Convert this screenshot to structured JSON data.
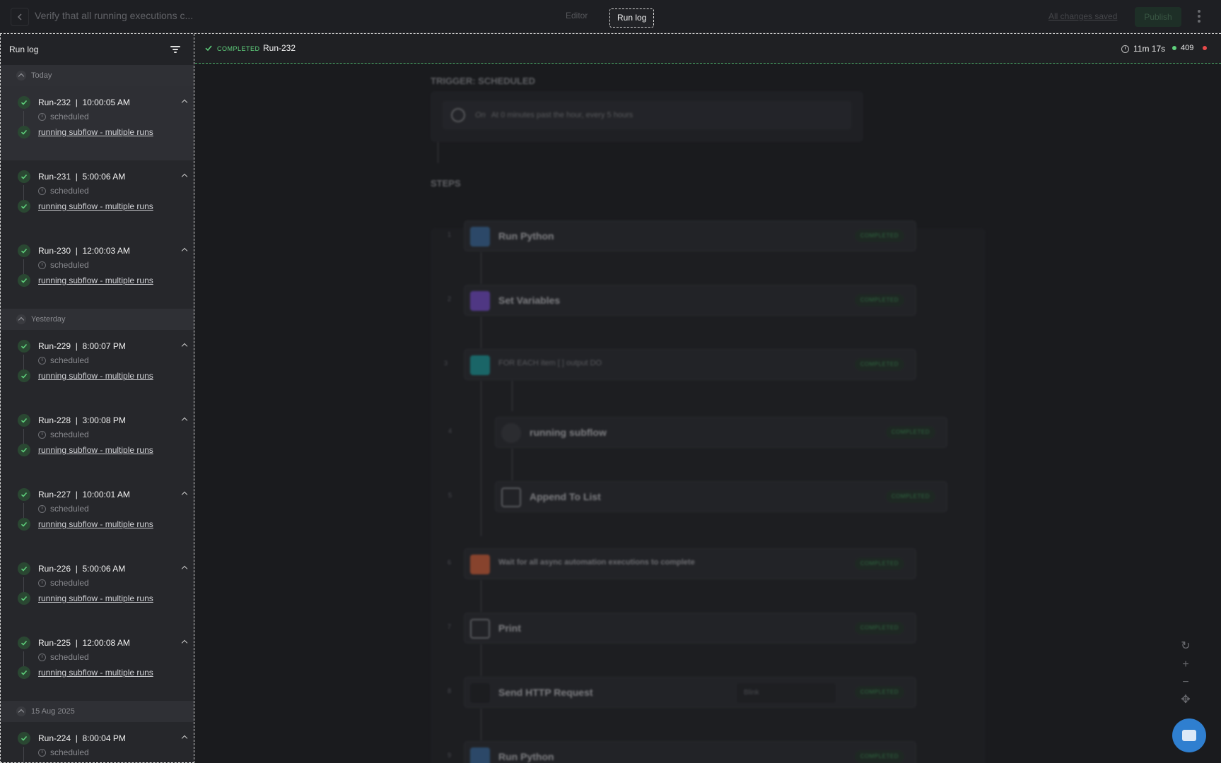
{
  "topbar": {
    "workflow_title": "Verify that all running executions c...",
    "mode_editor": "Editor",
    "mode_runlog": "Run log",
    "saved_status": "All changes saved",
    "publish_label": "Publish"
  },
  "sidebar": {
    "title": "Run log",
    "groups": [
      {
        "label": "Today",
        "runs": [
          {
            "id": "Run-232",
            "time": "10:00:05 AM",
            "trigger": "scheduled",
            "subflow": "running subflow - multiple runs"
          },
          {
            "id": "Run-231",
            "time": "5:00:06 AM",
            "trigger": "scheduled",
            "subflow": "running subflow - multiple runs"
          },
          {
            "id": "Run-230",
            "time": "12:00:03 AM",
            "trigger": "scheduled",
            "subflow": "running subflow - multiple runs"
          }
        ]
      },
      {
        "label": "Yesterday",
        "runs": [
          {
            "id": "Run-229",
            "time": "8:00:07 PM",
            "trigger": "scheduled",
            "subflow": "running subflow - multiple runs"
          },
          {
            "id": "Run-228",
            "time": "3:00:08 PM",
            "trigger": "scheduled",
            "subflow": "running subflow - multiple runs"
          },
          {
            "id": "Run-227",
            "time": "10:00:01 AM",
            "trigger": "scheduled",
            "subflow": "running subflow - multiple runs"
          },
          {
            "id": "Run-226",
            "time": "5:00:06 AM",
            "trigger": "scheduled",
            "subflow": "running subflow - multiple runs"
          },
          {
            "id": "Run-225",
            "time": "12:00:08 AM",
            "trigger": "scheduled",
            "subflow": "running subflow - multiple runs"
          }
        ]
      },
      {
        "label": "15 Aug 2025",
        "runs": [
          {
            "id": "Run-224",
            "time": "8:00:04 PM",
            "trigger": "scheduled",
            "subflow": "running subflow - multiple runs"
          }
        ]
      }
    ]
  },
  "status": {
    "state": "COMPLETED",
    "run_id": "Run-232",
    "duration": "11m 17s",
    "count": "409",
    "success_color": "#5fd07c",
    "error_color": "#e84a4a"
  },
  "flow": {
    "trigger_heading": "TRIGGER: SCHEDULED",
    "trigger_on": "On",
    "trigger_schedule": "At 0 minutes past the hour, every 5 hours",
    "steps_heading": "STEPS",
    "completed_badge": "COMPLETED",
    "steps": [
      {
        "num": "1",
        "name": "Run Python",
        "icon": "python-icon",
        "color": "#3b6ea5"
      },
      {
        "num": "2",
        "name": "Set Variables",
        "icon": "variables-icon",
        "color": "#7b4fd6"
      },
      {
        "num": "3",
        "name": "FOR EACH item [ ] output DO",
        "icon": "loop-icon",
        "color": "#1aa3a3"
      },
      {
        "num": "4",
        "name": "running subflow",
        "icon": "subflow-icon",
        "color": "#3a3b40"
      },
      {
        "num": "5",
        "name": "Append To List",
        "icon": "wrench-icon",
        "color": "#2a2b30"
      },
      {
        "num": "6",
        "name": "Wait for all async automation executions to complete",
        "icon": "wait-icon",
        "color": "#e0643a"
      },
      {
        "num": "7",
        "name": "Print",
        "icon": "wrench-icon",
        "color": "#2a2b30"
      },
      {
        "num": "8",
        "name": "Send HTTP Request",
        "icon": "http-icon",
        "color": "#1e1f23",
        "extra": "Blink"
      },
      {
        "num": "9",
        "name": "Run Python",
        "icon": "python-icon",
        "color": "#3b6ea5"
      }
    ]
  },
  "zoom_controls": {
    "reset_icon": "refresh-icon",
    "zoom_in_icon": "plus-icon",
    "zoom_out_icon": "minus-icon",
    "fit_icon": "move-icon"
  },
  "chat": {
    "icon": "chat-icon"
  }
}
